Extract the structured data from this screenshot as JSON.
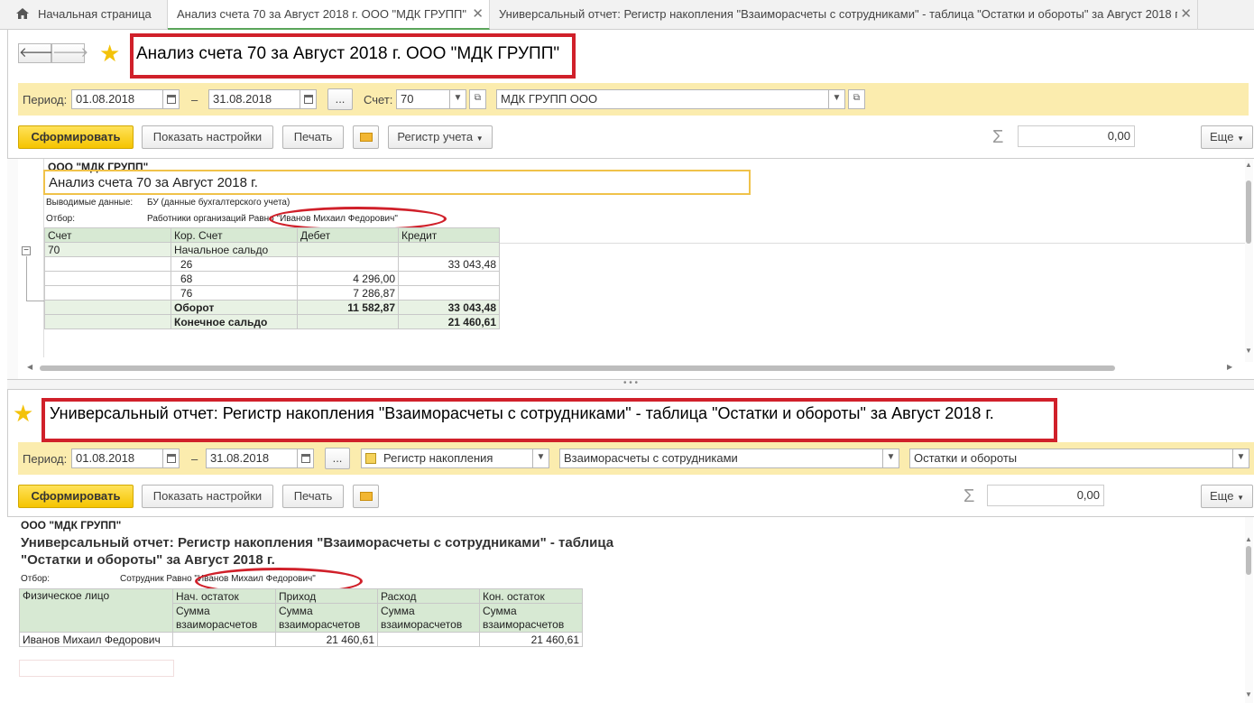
{
  "tabs": [
    {
      "label": "Начальная страница"
    },
    {
      "label": "Анализ счета 70 за Август 2018 г. ООО \"МДК ГРУПП\""
    },
    {
      "label": "Универсальный отчет: Регистр накопления \"Взаиморасчеты с сотрудниками\" - таблица \"Остатки и обороты\" за Август 2018 г."
    }
  ],
  "top": {
    "title": "Анализ счета 70 за Август 2018 г. ООО \"МДК ГРУПП\"",
    "params": {
      "period_label": "Период:",
      "date_from": "01.08.2018",
      "dash": "–",
      "date_to": "31.08.2018",
      "dots": "...",
      "account_label": "Счет:",
      "account": "70",
      "org": "МДК ГРУПП ООО"
    },
    "toolbar": {
      "generate": "Сформировать",
      "show_settings": "Показать настройки",
      "print": "Печать",
      "register": "Регистр учета",
      "sum": "0,00",
      "more": "Еще"
    },
    "report": {
      "org": "ООО \"МДК ГРУПП\"",
      "title": "Анализ счета 70 за Август 2018 г.",
      "output_label": "Выводимые данные:",
      "output_value": "БУ (данные бухгалтерского учета)",
      "filter_label": "Отбор:",
      "filter_value": "Работники организаций Равно \"Иванов Михаил Федорович\"",
      "headers": [
        "Счет",
        "Кор. Счет",
        "Дебет",
        "Кредит"
      ],
      "rows": [
        {
          "account": "70",
          "corr": "Начальное сальдо",
          "debit": "",
          "credit": ""
        },
        {
          "account": "",
          "corr": "26",
          "debit": "",
          "credit": "33 043,48"
        },
        {
          "account": "",
          "corr": "68",
          "debit": "4 296,00",
          "credit": ""
        },
        {
          "account": "",
          "corr": "76",
          "debit": "7 286,87",
          "credit": ""
        },
        {
          "account": "",
          "corr": "Оборот",
          "debit": "11 582,87",
          "credit": "33 043,48"
        },
        {
          "account": "",
          "corr": "Конечное сальдо",
          "debit": "",
          "credit": "21 460,61"
        }
      ]
    }
  },
  "bottom": {
    "title": "Универсальный отчет: Регистр накопления \"Взаиморасчеты с сотрудниками\" - таблица \"Остатки и обороты\" за Август 2018 г.",
    "params": {
      "period_label": "Период:",
      "date_from": "01.08.2018",
      "dash": "–",
      "date_to": "31.08.2018",
      "dots": "...",
      "register_type": "Регистр накопления",
      "register_name": "Взаиморасчеты с сотрудниками",
      "table_name": "Остатки и обороты"
    },
    "toolbar": {
      "generate": "Сформировать",
      "show_settings": "Показать настройки",
      "print": "Печать",
      "sum": "0,00",
      "more": "Еще"
    },
    "report": {
      "org": "ООО \"МДК ГРУПП\"",
      "title_line1": "Универсальный отчет: Регистр накопления \"Взаиморасчеты с сотрудниками\" - таблица",
      "title_line2": "\"Остатки и обороты\" за Август 2018 г.",
      "filter_label": "Отбор:",
      "filter_value": "Сотрудник Равно \"Иванов Михаил Федорович\"",
      "headers": [
        "Физическое лицо",
        "Нач. остаток",
        "Приход",
        "Расход",
        "Кон. остаток"
      ],
      "subheader": "Сумма взаиморасчетов",
      "rows": [
        {
          "person": "Иванов Михаил Федорович",
          "start": "",
          "income": "21 460,61",
          "expense": "",
          "end": "21 460,61"
        }
      ]
    }
  }
}
